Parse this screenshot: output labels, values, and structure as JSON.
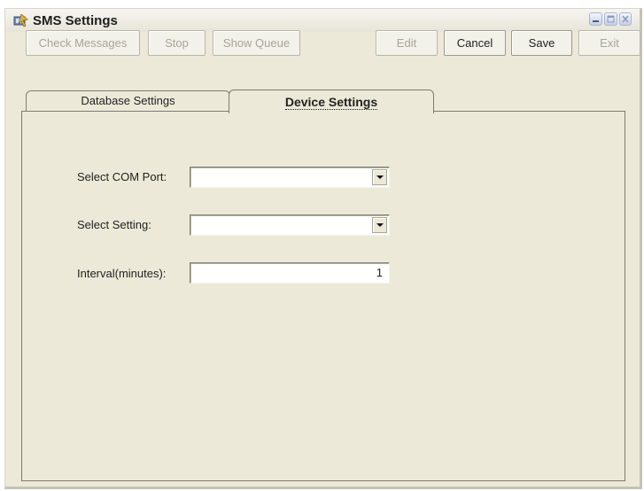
{
  "window": {
    "title": "SMS Settings"
  },
  "toolbar": {
    "check_messages": "Check Messages",
    "stop": "Stop",
    "show_queue": "Show Queue",
    "edit": "Edit",
    "cancel": "Cancel",
    "save": "Save",
    "exit": "Exit"
  },
  "tabs": [
    {
      "label": "Database Settings",
      "active": false
    },
    {
      "label": "Device Settings",
      "active": true
    }
  ],
  "form": {
    "com_port": {
      "label": "Select COM Port:",
      "value": ""
    },
    "setting": {
      "label": "Select Setting:",
      "value": ""
    },
    "interval": {
      "label": "Interval(minutes):",
      "value": "1"
    }
  },
  "icons": {
    "app": "sms-settings-icon",
    "minimize": "minimize-icon",
    "maximize": "maximize-icon",
    "close": "close-icon",
    "dropdown": "dropdown-arrow-icon"
  }
}
